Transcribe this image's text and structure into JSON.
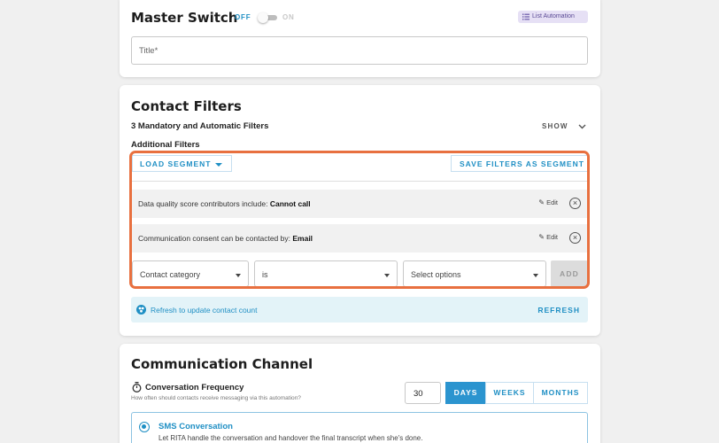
{
  "master": {
    "title": "Master Switch",
    "toggle_off": "OFF",
    "toggle_on": "ON",
    "badge": "List Automation",
    "title_placeholder": "Title*"
  },
  "contact_filters": {
    "title": "Contact Filters",
    "mandatory": "3 Mandatory and Automatic Filters",
    "show": "SHOW",
    "additional": "Additional Filters",
    "load_segment": "LOAD SEGMENT",
    "save_filters": "SAVE FILTERS AS SEGMENT",
    "filters": [
      {
        "prefix": "Data quality score contributors include: ",
        "value": "Cannot call",
        "edit": "Edit"
      },
      {
        "prefix": "Communication consent can be contacted by: ",
        "value": "Email",
        "edit": "Edit"
      }
    ],
    "new_filter": {
      "field": "Contact category",
      "operator": "is",
      "value_placeholder": "Select options",
      "add": "ADD"
    },
    "refresh_note": "Refresh to update contact count",
    "refresh": "REFRESH"
  },
  "channel": {
    "title": "Communication Channel",
    "frequency_label": "Conversation Frequency",
    "frequency_help": "How often should contacts receive messaging via this automation?",
    "frequency_value": "30",
    "units": [
      "DAYS",
      "WEEKS",
      "MONTHS"
    ],
    "selected_unit": "DAYS",
    "sms_title": "SMS Conversation",
    "sms_desc": "Let RITA handle the conversation and handover the final transcript when she's done."
  },
  "colors": {
    "accent": "#1f8fc4",
    "highlight": "#e8703f",
    "badge_bg": "#e6e0f5"
  }
}
